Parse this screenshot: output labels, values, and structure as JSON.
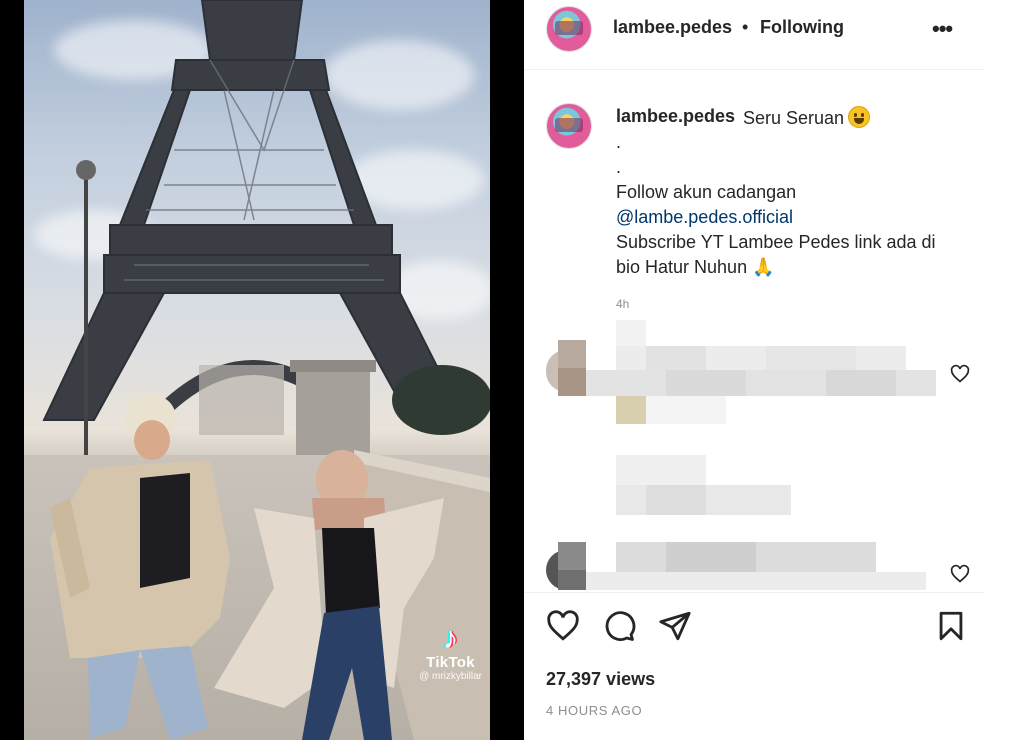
{
  "post": {
    "username": "lambee.pedes",
    "separator": "•",
    "follow_status": "Following",
    "more_label": "•••"
  },
  "caption": {
    "username": "lambee.pedes",
    "title": "Seru Seruan",
    "dot1": ".",
    "dot2": ".",
    "line1": "Follow akun cadangan",
    "mention": "@lambe.pedes.official",
    "line3": "Subscribe YT Lambee Pedes link ada di",
    "line4": "bio Hatur Nuhun",
    "age": "4h"
  },
  "video": {
    "watermark_name": "TikTok",
    "watermark_handle": "@ mrizkybillar"
  },
  "stats": {
    "views": "27,397 views",
    "posted": "4 HOURS AGO"
  },
  "icons": {
    "like": "heart-icon",
    "comment": "comment-icon",
    "share": "paper-plane-icon",
    "save": "bookmark-icon",
    "more": "more-horizontal-icon"
  }
}
